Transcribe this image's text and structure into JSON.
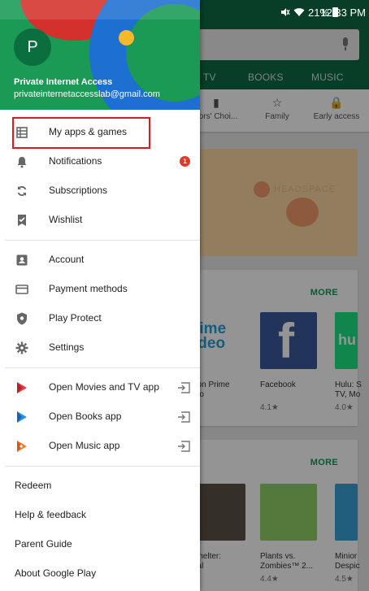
{
  "status_bar": {
    "battery": "21%",
    "time": "12:33 PM"
  },
  "background": {
    "tabs": [
      "TV",
      "BOOKS",
      "MUSIC"
    ],
    "categories": [
      "itors' Choi...",
      "Family",
      "Early access"
    ],
    "banner_text": "HEADSPACE",
    "section1": {
      "more": "MORE",
      "apps": [
        {
          "title": "azon Prime\nideo",
          "rating": "★"
        },
        {
          "title": "Facebook",
          "rating": "4.1★"
        },
        {
          "title": "Hulu: S\nTV, Mo",
          "rating": "4.0★"
        }
      ]
    },
    "section2": {
      "more": "MORE",
      "apps": [
        {
          "title": "t Shelter:\nrival",
          "rating": "★"
        },
        {
          "title": "Plants vs.\nZombies™ 2...",
          "rating": "4.4★"
        },
        {
          "title": "Minior\nDespic",
          "rating": "4.5★"
        }
      ]
    },
    "prime_text": "rime\nideo",
    "hulu_text": "hu"
  },
  "drawer": {
    "account": {
      "initial": "P",
      "name": "Private Internet Access",
      "email": "privateinternetaccesslab@gmail.com"
    },
    "group1": [
      {
        "label": "My apps & games",
        "icon": "apps-list-icon"
      },
      {
        "label": "Notifications",
        "icon": "bell-icon",
        "badge": "1"
      },
      {
        "label": "Subscriptions",
        "icon": "refresh-icon"
      },
      {
        "label": "Wishlist",
        "icon": "bookmark-check-icon"
      }
    ],
    "group2": [
      {
        "label": "Account",
        "icon": "account-box-icon"
      },
      {
        "label": "Payment methods",
        "icon": "credit-card-icon"
      },
      {
        "label": "Play Protect",
        "icon": "shield-icon"
      },
      {
        "label": "Settings",
        "icon": "gear-icon"
      }
    ],
    "group3": [
      {
        "label": "Open Movies and TV app",
        "icon": "play-movies-icon"
      },
      {
        "label": "Open Books app",
        "icon": "play-books-icon"
      },
      {
        "label": "Open Music app",
        "icon": "play-music-icon"
      }
    ],
    "group4": [
      "Redeem",
      "Help & feedback",
      "Parent Guide",
      "About Google Play"
    ]
  }
}
